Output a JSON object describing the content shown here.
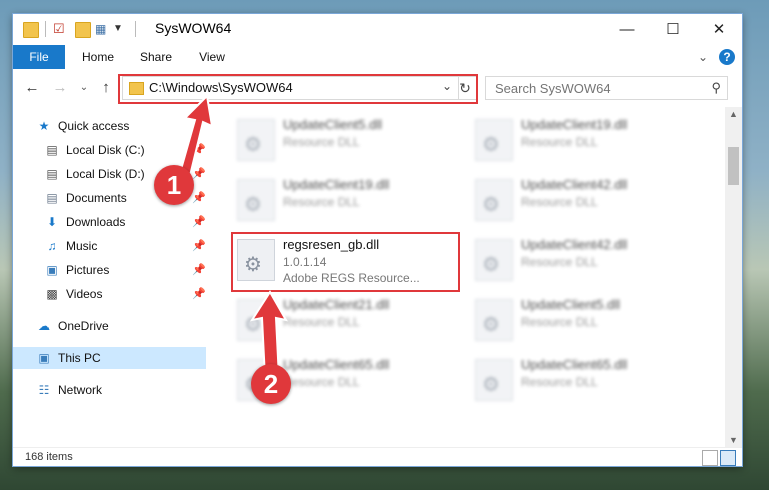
{
  "window": {
    "title": "SysWOW64",
    "minimize_icon": "minimize-icon",
    "maximize_icon": "maximize-icon",
    "close_icon": "close-icon"
  },
  "ribbon": {
    "tabs": [
      {
        "label": "File"
      },
      {
        "label": "Home"
      },
      {
        "label": "Share"
      },
      {
        "label": "View"
      }
    ]
  },
  "address": {
    "path": "C:\\Windows\\SysWOW64"
  },
  "search": {
    "placeholder": "Search SysWOW64"
  },
  "nav": {
    "items": [
      {
        "label": "Quick access",
        "icon": "star-icon"
      },
      {
        "label": "Local Disk (C:)",
        "icon": "drive-icon"
      },
      {
        "label": "Local Disk (D:)",
        "icon": "drive-icon"
      },
      {
        "label": "Documents",
        "icon": "documents-icon"
      },
      {
        "label": "Downloads",
        "icon": "download-icon"
      },
      {
        "label": "Music",
        "icon": "music-icon"
      },
      {
        "label": "Pictures",
        "icon": "pictures-icon"
      },
      {
        "label": "Videos",
        "icon": "videos-icon"
      },
      {
        "label": "OneDrive",
        "icon": "cloud-icon"
      },
      {
        "label": "This PC",
        "icon": "computer-icon"
      },
      {
        "label": "Network",
        "icon": "network-icon"
      }
    ]
  },
  "files": {
    "left": [
      {
        "name": "UpdateClient5.dll",
        "line1": "Resource DLL"
      },
      {
        "name": "UpdateClient19.dll",
        "line1": "Resource DLL"
      },
      {
        "name": "regsresen_gb.dll",
        "line1": "1.0.1.14",
        "line2": "Adobe REGS Resource..."
      },
      {
        "name": "UpdateClient21.dll",
        "line1": "Resource DLL"
      },
      {
        "name": "UpdateClient65.dll",
        "line1": "Resource DLL"
      }
    ],
    "right": [
      {
        "name": "UpdateClient19.dll",
        "line1": "Resource DLL"
      },
      {
        "name": "UpdateClient42.dll",
        "line1": "Resource DLL"
      },
      {
        "name": "UpdateClient42.dll",
        "line1": "Resource DLL"
      },
      {
        "name": "UpdateClient5.dll",
        "line1": "Resource DLL"
      },
      {
        "name": "UpdateClient65.dll",
        "line1": "Resource DLL"
      }
    ]
  },
  "status": {
    "items_count": "168 items"
  },
  "annotations": {
    "step1": "1",
    "step2": "2",
    "accent": "#e0383b"
  }
}
